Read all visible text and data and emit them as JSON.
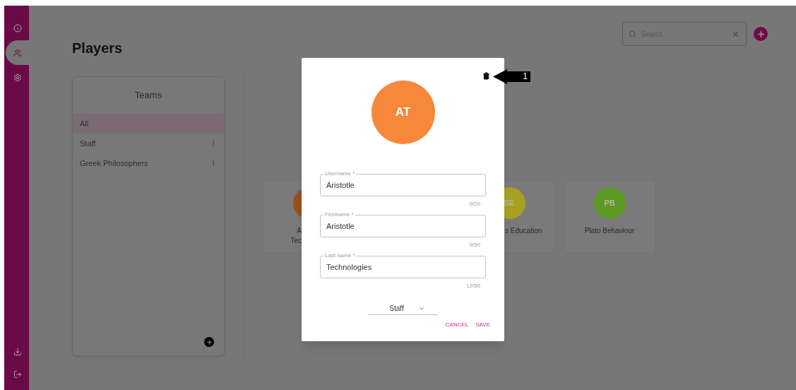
{
  "sidebar": {
    "items": [
      {
        "kind": "info",
        "selected": false
      },
      {
        "kind": "players",
        "selected": true
      },
      {
        "kind": "settings",
        "selected": false
      }
    ],
    "bottom_items": [
      {
        "kind": "download"
      },
      {
        "kind": "logout"
      }
    ]
  },
  "page_title": "Players",
  "search": {
    "placeholder": "Search"
  },
  "teams": {
    "title": "Teams",
    "items": [
      {
        "label": "All",
        "selected": true,
        "menu": false
      },
      {
        "label": "Staff",
        "selected": false,
        "menu": true
      },
      {
        "label": "Greek Philosophers",
        "selected": false,
        "menu": true
      }
    ]
  },
  "players": [
    {
      "kind": "cut_right",
      "name_lines": [
        "A",
        "Tec"
      ],
      "color": "#9a4e1e"
    },
    {
      "kind": "cut_left",
      "initials": "SE",
      "name_lines": [
        "s Education"
      ],
      "color": "#a8a020"
    },
    {
      "kind": "whole",
      "initials": "PB",
      "name_lines": [
        "Plato Behaviour"
      ],
      "color": "#5e9a26"
    }
  ],
  "dialog": {
    "initials": "AT",
    "color": "#f7873b",
    "fields": [
      {
        "label": "Username *",
        "value": "Aristotle",
        "counter": "9/20"
      },
      {
        "label": "Firstname *",
        "value": "Aristotle",
        "counter": "9/50"
      },
      {
        "label": "Last name *",
        "value": "Technologies",
        "counter": "12/50"
      }
    ],
    "team": "Staff",
    "buttons": [
      "CANCEL",
      "SAVE"
    ],
    "callout": "1"
  }
}
